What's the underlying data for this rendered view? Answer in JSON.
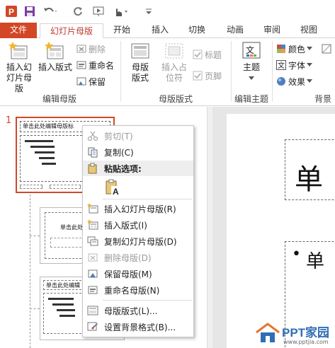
{
  "qat": {
    "app_icon": "powerpoint-icon",
    "save_icon": "save-icon",
    "undo_icon": "undo-icon",
    "redo_icon": "redo-icon",
    "slideshow_icon": "slideshow-icon",
    "touch_icon": "touch-mode-icon",
    "customize_icon": "customize-qat-icon"
  },
  "tabs": [
    {
      "label": "文件"
    },
    {
      "label": "幻灯片母版"
    },
    {
      "label": "开始"
    },
    {
      "label": "插入"
    },
    {
      "label": "切换"
    },
    {
      "label": "动画"
    },
    {
      "label": "审阅"
    },
    {
      "label": "视图"
    }
  ],
  "ribbon": {
    "edit_master": {
      "insert_slide_master": "插入幻灯片母版",
      "insert_layout": "插入版式",
      "delete": "删除",
      "rename": "重命名",
      "preserve": "保留",
      "group_label": "编辑母版"
    },
    "master_layout": {
      "master_layout": "母版版式",
      "insert_placeholder": "插入占位符",
      "title": "标题",
      "footer": "页脚",
      "group_label": "母版版式"
    },
    "edit_theme": {
      "themes": "主题",
      "group_label": "编辑主题"
    },
    "background": {
      "colors": "颜色",
      "fonts": "字体",
      "effects": "效果",
      "group_label": "背景"
    }
  },
  "thumbs": {
    "slide_number": "1",
    "master_title": "单击此处编辑母版标",
    "layout_title_2": "单击此处",
    "layout_title_3": "单击此处编辑"
  },
  "editor": {
    "big_char": "单",
    "bullet_char": "单",
    "bullet_symbol": "•"
  },
  "context_menu": {
    "cut": "剪切(T)",
    "copy": "复制(C)",
    "paste_options": "粘贴选项:",
    "insert_slide_master": "插入幻灯片母版(R)",
    "insert_layout": "插入版式(I)",
    "duplicate_slide_master": "复制幻灯片母版(D)",
    "delete_master": "删除母版(D)",
    "preserve_master": "保留母版(M)",
    "rename_master": "重命名母版(N)",
    "master_layout": "母版版式(L)...",
    "format_background": "设置背景格式(B)..."
  },
  "watermarks": {
    "center": "PPT家园",
    "site": "www.pptjia.com"
  },
  "colors": {
    "accent": "#d24726",
    "tab_active_text": "#c0392b",
    "selection_border": "#d24726"
  }
}
